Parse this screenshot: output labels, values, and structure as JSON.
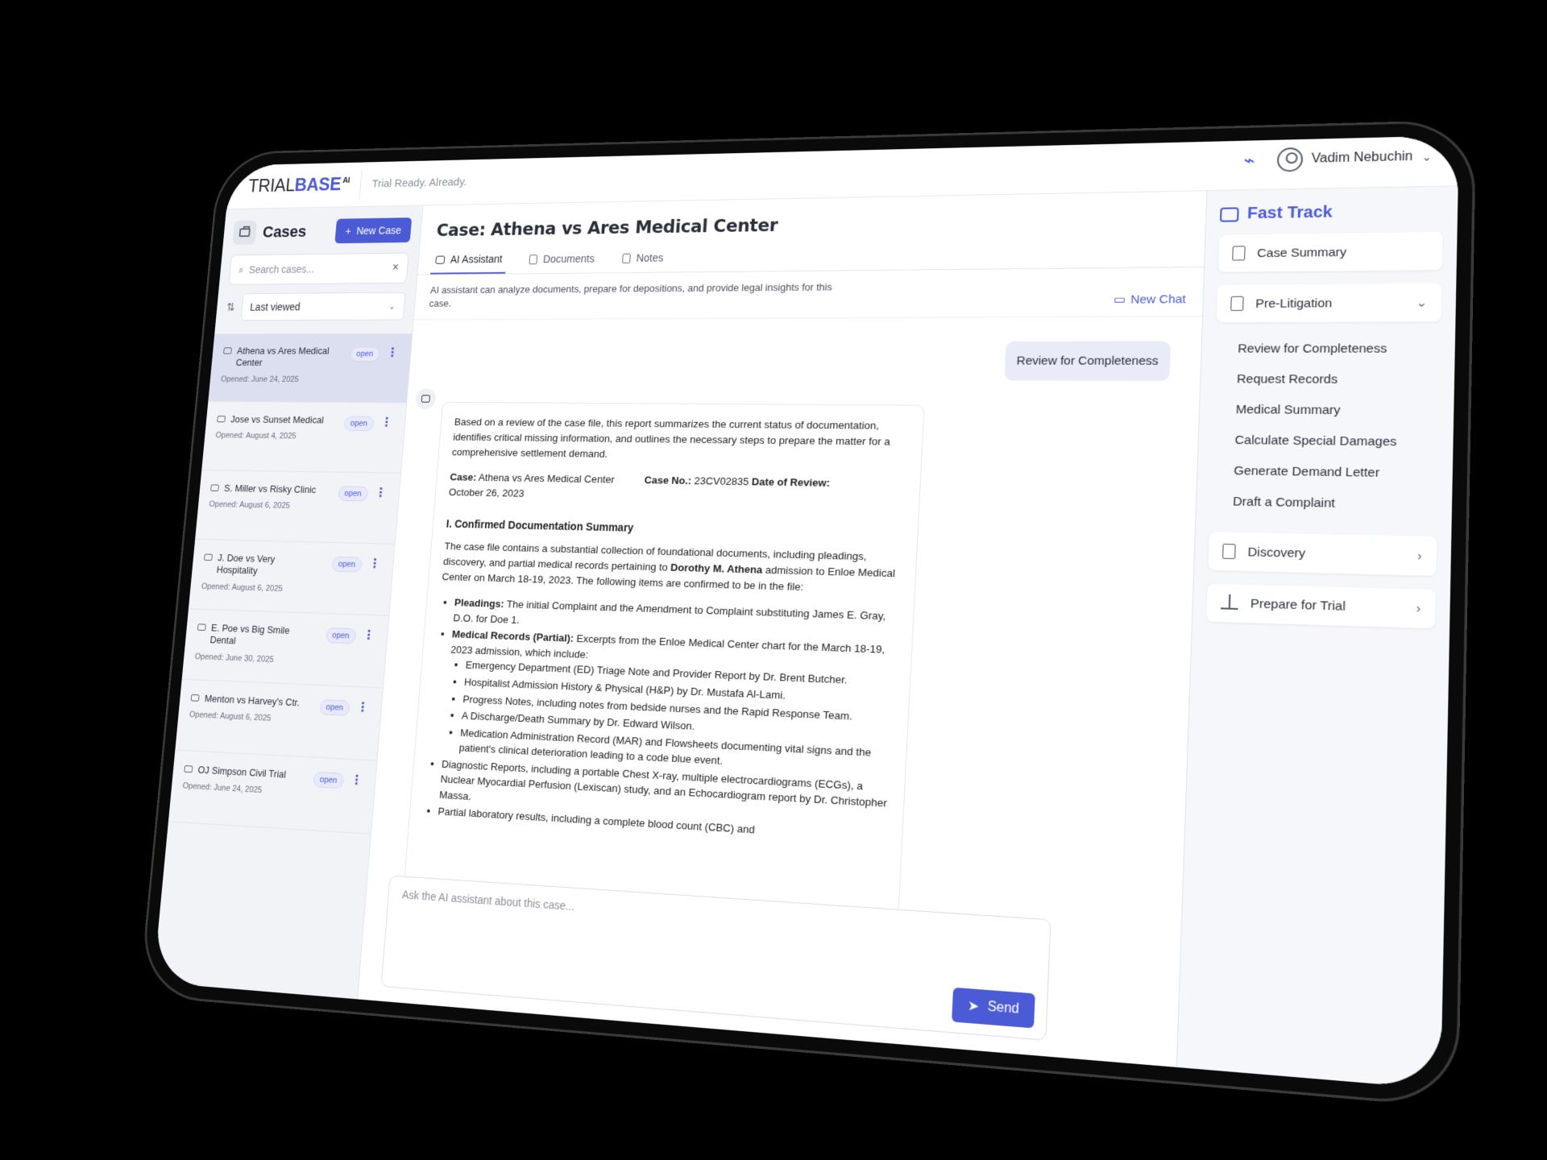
{
  "brand": {
    "part1": "TRIAL",
    "part2": "BASE",
    "part3": "AI",
    "tagline": "Trial Ready. Already."
  },
  "user": {
    "name": "Vadim Nebuchin"
  },
  "sidebar": {
    "title": "Cases",
    "new_case_label": "New Case",
    "search_placeholder": "Search cases...",
    "sort_value": "Last viewed",
    "cases": [
      {
        "name": "Athena vs Ares Medical Center",
        "date": "Opened: June 24, 2025",
        "status": "open"
      },
      {
        "name": "Jose vs Sunset Medical",
        "date": "Opened: August 4, 2025",
        "status": "open"
      },
      {
        "name": "S. Miller vs Risky Clinic",
        "date": "Opened: August 6, 2025",
        "status": "open"
      },
      {
        "name": "J. Doe vs Very Hospitality",
        "date": "Opened: August 6, 2025",
        "status": "open"
      },
      {
        "name": "E. Poe vs Big Smile Dental",
        "date": "Opened: June 30, 2025",
        "status": "open"
      },
      {
        "name": "Menton vs Harvey's Ctr.",
        "date": "Opened: August 6, 2025",
        "status": "open"
      },
      {
        "name": "OJ Simpson Civil Trial",
        "date": "Opened: June 24, 2025",
        "status": "open"
      }
    ]
  },
  "main": {
    "case_title": "Case: Athena vs Ares Medical Center",
    "tabs": [
      {
        "label": "AI Assistant"
      },
      {
        "label": "Documents"
      },
      {
        "label": "Notes"
      }
    ],
    "assistant_note": "AI assistant can analyze documents, prepare for depositions, and provide legal insights for this case.",
    "new_chat_label": "New Chat",
    "user_message": "Review for Completeness",
    "report": {
      "intro": "Based on a review of the case file, this report summarizes the current status of documentation, identifies critical missing information, and outlines the necessary steps to prepare the matter for a comprehensive settlement demand.",
      "case_label": "Case:",
      "case_value": "Athena vs Ares Medical Center",
      "case_no_label": "Case No.:",
      "case_no_value": "23CV02835",
      "review_label": "Date of Review:",
      "review_date": "October 26, 2023",
      "section_title": "I. Confirmed Documentation Summary",
      "section_intro_a": "The case file contains a substantial collection of foundational documents, including pleadings, discovery, and partial medical records pertaining to",
      "section_intro_name": "Dorothy M. Athena",
      "section_intro_b": "admission to Enloe Medical Center on March 18-19, 2023. The following items are confirmed to be in the file:",
      "pleadings_label": "Pleadings:",
      "pleadings_text": "The initial Complaint and the Amendment to Complaint substituting James E. Gray, D.O. for Doe 1.",
      "medical_label": "Medical Records (Partial):",
      "medical_text": "Excerpts from the Enloe Medical Center chart for the March 18-19, 2023 admission, which include:",
      "medical_items": [
        "Emergency Department (ED) Triage Note and Provider Report by Dr. Brent Butcher.",
        "Hospitalist Admission History & Physical (H&P) by Dr. Mustafa Al-Lami.",
        "Progress Notes, including notes from bedside nurses and the Rapid Response Team.",
        "A Discharge/Death Summary by Dr. Edward Wilson.",
        "Medication Administration Record (MAR) and Flowsheets documenting vital signs and the patient's clinical deterioration leading to a code blue event."
      ],
      "diagnostic_text": "Diagnostic Reports, including a portable Chest X-ray, multiple electrocardiograms (ECGs), a Nuclear Myocardial Perfusion (Lexiscan) study, and an Echocardiogram report by Dr. Christopher Massa.",
      "lab_text": "Partial laboratory results, including a complete blood count (CBC) and"
    },
    "composer_placeholder": "Ask the AI assistant about this case...",
    "send_label": "Send"
  },
  "fast_track": {
    "title": "Fast Track",
    "case_summary": "Case Summary",
    "pre_litigation": "Pre-Litigation",
    "pre_items": [
      "Review for Completeness",
      "Request Records",
      "Medical Summary",
      "Calculate Special Damages",
      "Generate Demand Letter",
      "Draft a Complaint"
    ],
    "discovery": "Discovery",
    "prepare_trial": "Prepare for Trial"
  },
  "colors": {
    "accent": "#4b5bd6",
    "active_case_bg": "#dcdff0",
    "page_bg": "#000000"
  }
}
